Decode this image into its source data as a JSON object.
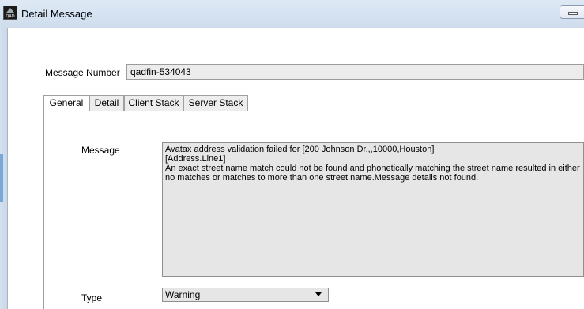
{
  "window": {
    "title": "Detail Message",
    "icon": "qad-logo-icon",
    "icon_text": "QAD"
  },
  "form": {
    "message_number_label": "Message Number",
    "message_number_value": "qadfin-534043"
  },
  "tabs": [
    {
      "label": "General",
      "active": true
    },
    {
      "label": "Detail",
      "active": false
    },
    {
      "label": "Client Stack",
      "active": false
    },
    {
      "label": "Server Stack",
      "active": false
    }
  ],
  "general": {
    "message_label": "Message",
    "message_text": "Avatax address validation failed for [200 Johnson Dr,,,10000,Houston]\n [Address.Line1]\nAn exact street name match could not be found and phonetically matching the street name resulted in either no matches or matches to more than one street name.Message details not found.",
    "type_label": "Type",
    "type_value": "Warning"
  }
}
